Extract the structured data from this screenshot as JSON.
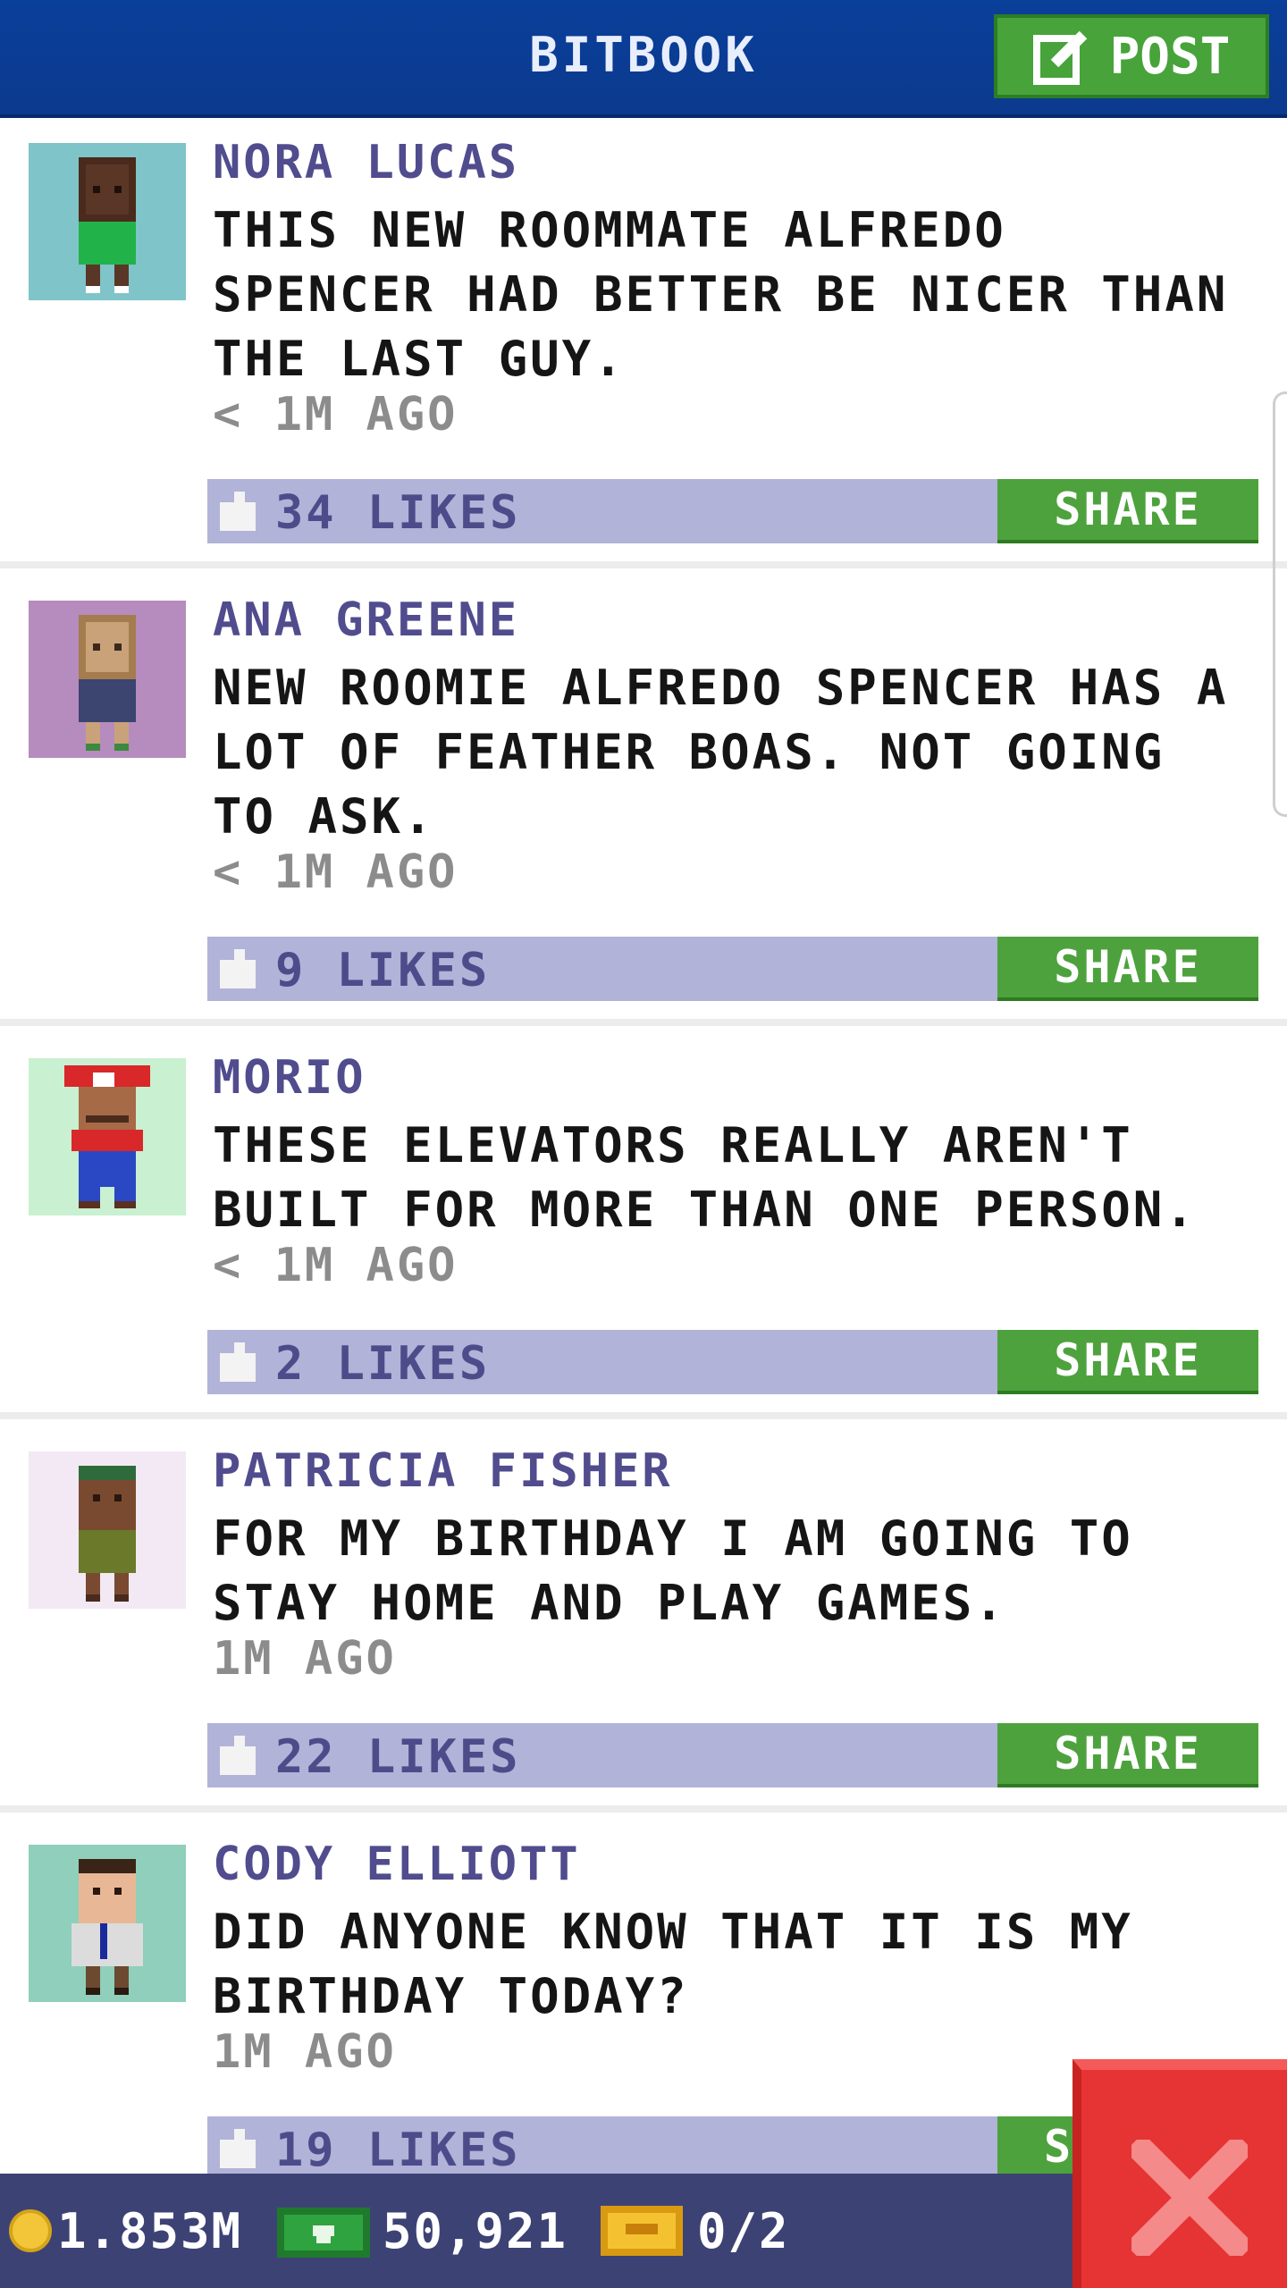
{
  "header": {
    "title": "BITBOOK",
    "post_label": "POST"
  },
  "posts": [
    {
      "name": "NORA LUCAS",
      "text": "THIS NEW ROOMMATE ALFREDO SPENCER HAD BETTER BE NICER THAN THE LAST GUY.",
      "time": "< 1M AGO",
      "likes": "34 LIKES",
      "share": "SHARE",
      "avatar_bg": "#7fc4c8"
    },
    {
      "name": "ANA GREENE",
      "text": "NEW ROOMIE ALFREDO SPENCER HAS A LOT OF FEATHER BOAS. NOT GOING TO ASK.",
      "time": "< 1M AGO",
      "likes": "9 LIKES",
      "share": "SHARE",
      "avatar_bg": "#b58cbd"
    },
    {
      "name": "MORIO",
      "text": "THESE ELEVATORS REALLY AREN'T BUILT FOR MORE THAN ONE PERSON.",
      "time": "< 1M AGO",
      "likes": "2 LIKES",
      "share": "SHARE",
      "avatar_bg": "#c9f0d0"
    },
    {
      "name": "PATRICIA FISHER",
      "text": "FOR MY BIRTHDAY I AM GOING TO STAY HOME AND PLAY GAMES.",
      "time": "1M AGO",
      "likes": "22 LIKES",
      "share": "SHARE",
      "avatar_bg": "#f2e9f5"
    },
    {
      "name": "CODY ELLIOTT",
      "text": "DID ANYONE KNOW THAT IT IS MY BIRTHDAY TODAY?",
      "time": "1M AGO",
      "likes": "19 LIKES",
      "share": "S",
      "avatar_bg": "#8fcfbb"
    }
  ],
  "footer": {
    "coins": "1.853M",
    "bux": "50,921",
    "tickets": "0/2"
  },
  "colors": {
    "header": "#0b3a8e",
    "share": "#4ea23d",
    "likes_bar": "#b1b3d8",
    "footer": "#3d4275",
    "close": "#e63434"
  }
}
